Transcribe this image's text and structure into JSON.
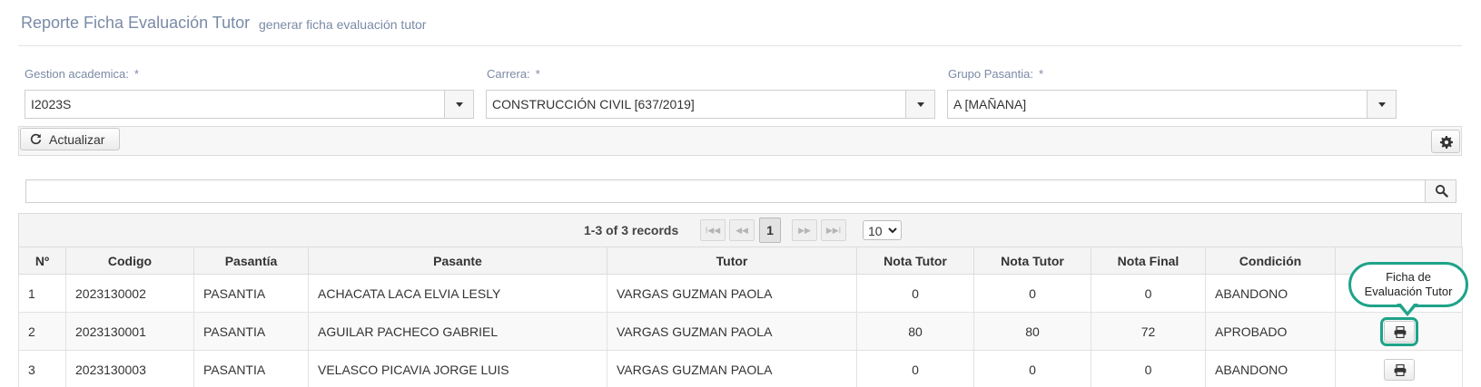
{
  "header": {
    "title": "Reporte Ficha Evaluación Tutor",
    "subtitle": "generar ficha evaluación tutor"
  },
  "filters": {
    "gestion": {
      "label": "Gestion academica:",
      "required": "*",
      "value": "I2023S"
    },
    "carrera": {
      "label": "Carrera:",
      "required": "*",
      "value": "CONSTRUCCIÓN CIVIL [637/2019]"
    },
    "grupo": {
      "label": "Grupo Pasantia:",
      "required": "*",
      "value": "A [MAÑANA]"
    }
  },
  "toolbar": {
    "refresh_label": "Actualizar"
  },
  "search": {
    "value": "",
    "placeholder": ""
  },
  "paginator": {
    "records": "1-3 of 3 records",
    "first": "I◀◀",
    "prev": "◀◀",
    "current_page": "1",
    "next": "▶▶",
    "last": "▶▶I",
    "rows_per_page": "10"
  },
  "table": {
    "columns": [
      "Nº",
      "Codigo",
      "Pasantía",
      "Pasante",
      "Tutor",
      "Nota Tutor",
      "Nota Tutor",
      "Nota Final",
      "Condición",
      ""
    ],
    "rows": [
      {
        "n": "1",
        "codigo": "2023130002",
        "pasantia": "PASANTIA",
        "pasante": "ACHACATA LACA ELVIA LESLY",
        "tutor": "VARGAS GUZMAN PAOLA",
        "nota1": "0",
        "nota2": "0",
        "final": "0",
        "condicion": "ABANDONO"
      },
      {
        "n": "2",
        "codigo": "2023130001",
        "pasantia": "PASANTIA",
        "pasante": "AGUILAR PACHECO GABRIEL",
        "tutor": "VARGAS GUZMAN PAOLA",
        "nota1": "80",
        "nota2": "80",
        "final": "72",
        "condicion": "APROBADO"
      },
      {
        "n": "3",
        "codigo": "2023130003",
        "pasantia": "PASANTIA",
        "pasante": "VELASCO PICAVIA JORGE LUIS",
        "tutor": "VARGAS GUZMAN PAOLA",
        "nota1": "0",
        "nota2": "0",
        "final": "0",
        "condicion": "ABANDONO"
      }
    ]
  },
  "callout": {
    "line1": "Ficha de",
    "line2": "Evaluación Tutor"
  },
  "icons": {
    "refresh": "refresh-icon",
    "settings": "gear-icon",
    "search": "search-icon",
    "print": "print-icon"
  },
  "colors": {
    "callout_accent": "#1fa38a",
    "label_text": "#7a8aa6"
  }
}
